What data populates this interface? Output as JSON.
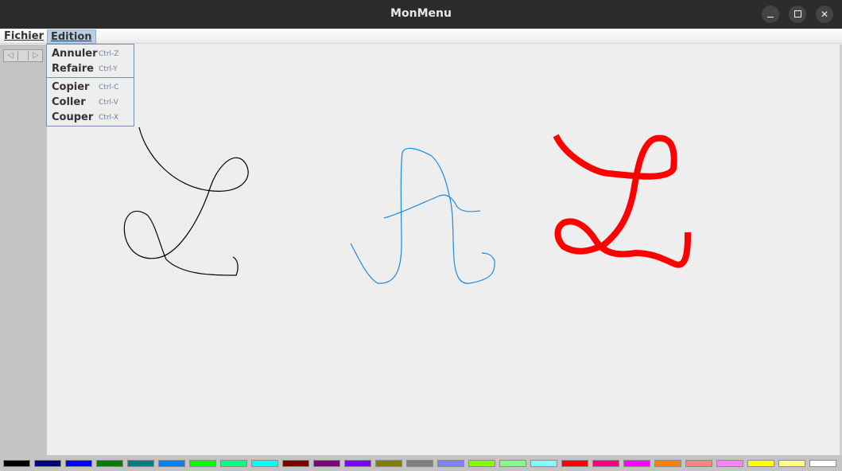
{
  "window": {
    "title": "MonMenu"
  },
  "menubar": {
    "file_label": "Fichier",
    "edit_label": "Edition"
  },
  "edit_menu": {
    "items": [
      {
        "label": "Annuler",
        "accel": "Ctrl-Z"
      },
      {
        "label": "Refaire",
        "accel": "Ctrl-Y"
      },
      {
        "label": "Copier",
        "accel": "Ctrl-C"
      },
      {
        "label": "Coller",
        "accel": "Ctrl-V"
      },
      {
        "label": "Couper",
        "accel": "Ctrl-X"
      }
    ]
  },
  "toolbar": {
    "left_arrow_icon": "triangle-left",
    "right_arrow_icon": "triangle-right"
  },
  "strokes": [
    {
      "name": "black-L-stroke",
      "color": "#000000",
      "width": "thin"
    },
    {
      "name": "blue-A-stroke",
      "color": "#1e88e5",
      "width": "thin"
    },
    {
      "name": "red-L-stroke",
      "color": "#ff0000",
      "width": "thick"
    }
  ],
  "palette": {
    "colors": [
      "#000000",
      "#000080",
      "#0000ff",
      "#008000",
      "#008080",
      "#0080ff",
      "#00ff00",
      "#00ff80",
      "#00ffff",
      "#800000",
      "#800080",
      "#8000ff",
      "#808000",
      "#808080",
      "#8080ff",
      "#80ff00",
      "#80ff80",
      "#80ffff",
      "#ff0000",
      "#ff0080",
      "#ff00ff",
      "#ff8000",
      "#ff8080",
      "#ff80ff",
      "#ffff00",
      "#ffff80",
      "#ffffff"
    ]
  }
}
